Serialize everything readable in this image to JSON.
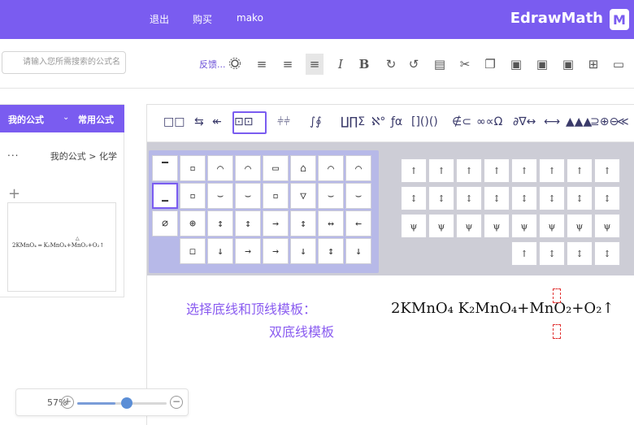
{
  "topbar": {
    "logo_text": "EdrawMath",
    "logo_mark": "M",
    "exit": "退出",
    "buy": "购买",
    "user": "mako"
  },
  "toolbar": {
    "search_placeholder": "请输入您所需搜索的公式名",
    "feedback": "反馈..."
  },
  "left_panel": {
    "tabs": [
      "常用公式",
      "我的公式"
    ],
    "breadcrumb": "我的公式 > 化学",
    "more": "...",
    "add": "+",
    "card_formula": "2KMnO₄ ═ K₂MnO₄+MnO₂+O₂↑",
    "card_delta": "△"
  },
  "symbol_bar": [
    "□□",
    "⇆",
    "↞",
    "⊡⊡",
    "⫩⫩",
    "∫∮",
    "∐∏Σ",
    "ℵ°",
    "ƒα",
    "[]()()",
    "∉⊂",
    "∞∝Ω",
    "∂∇↔",
    "⟷",
    "▲▲▲",
    "⊇⊕⊖",
    "≪"
  ],
  "left_palette": [
    [
      "▔",
      "▫",
      "⌒",
      "⌒",
      "▭",
      "⌂",
      "⌒",
      "⌒"
    ],
    [
      "▁",
      "▫",
      "⌣",
      "⌣",
      "▫",
      "▽",
      "⌣",
      "⌣"
    ],
    [
      "∅",
      "⊕",
      "↕",
      "↕",
      "→",
      "↕",
      "↔",
      "←"
    ],
    [
      "",
      "◻",
      "↓",
      "→",
      "→",
      "↓",
      "↕",
      "↓"
    ]
  ],
  "right_palette": [
    [
      "↑",
      "↑",
      "↑",
      "↑",
      "↑",
      "↑",
      "↑",
      "↑"
    ],
    [
      "↕",
      "↕",
      "↕",
      "↕",
      "↕",
      "↕",
      "↕",
      "↕"
    ],
    [
      "ψ",
      "ψ",
      "ψ",
      "ψ",
      "ψ",
      "ψ",
      "ψ",
      "ψ"
    ],
    [
      "↑",
      "↕",
      "↕",
      "↕"
    ]
  ],
  "canvas": {
    "hint_line1": "选择底线和顶线模板：",
    "hint_line2": "双底线模板",
    "equation": "2KMnO₄ K₂MnO₄+MnO₂+O₂↑"
  },
  "zoom": {
    "value": "57%",
    "level": 0.57
  }
}
